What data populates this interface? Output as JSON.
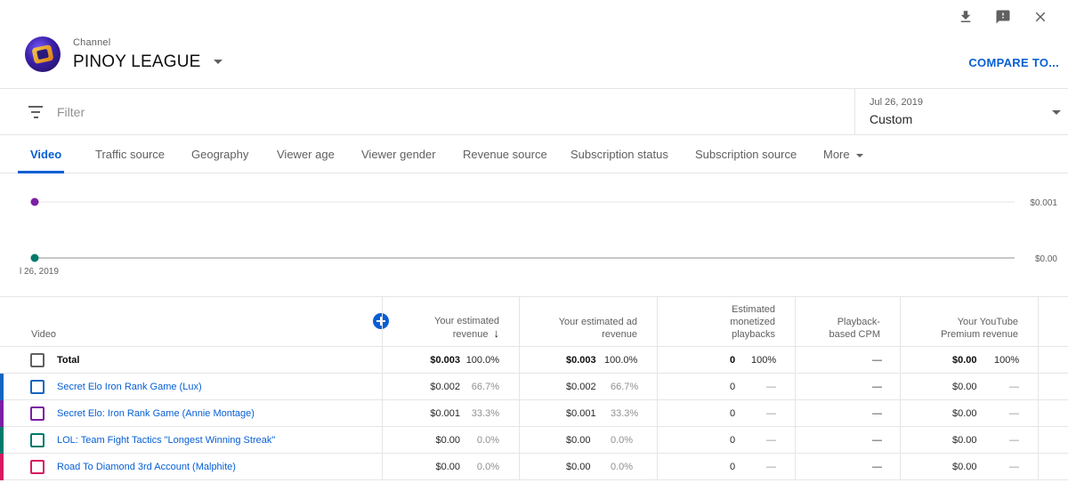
{
  "header": {
    "channel_label": "Channel",
    "channel_name": "PINOY LEAGUE",
    "compare_label": "COMPARE TO..."
  },
  "icons": {
    "download": "download-icon",
    "feedback": "feedback-icon",
    "close": "close-icon"
  },
  "filter": {
    "placeholder": "Filter",
    "date_range": "Jul 26, 2019",
    "date_label": "Custom"
  },
  "tabs": [
    {
      "label": "Video",
      "active": true
    },
    {
      "label": "Traffic source"
    },
    {
      "label": "Geography"
    },
    {
      "label": "Viewer age"
    },
    {
      "label": "Viewer gender"
    },
    {
      "label": "Revenue source"
    },
    {
      "label": "Subscription status"
    },
    {
      "label": "Subscription source"
    },
    {
      "label": "More"
    }
  ],
  "chart_data": {
    "type": "line",
    "x": [
      "l 26, 2019"
    ],
    "y_ticks": [
      "$0.001",
      "$0.00"
    ],
    "series": [
      {
        "color": "#7b1fa2",
        "values": [
          0.001
        ]
      },
      {
        "color": "#00796b",
        "values": [
          0.0
        ]
      }
    ],
    "grid": true
  },
  "table": {
    "columns": {
      "video": "Video",
      "est_revenue_1": "Your estimated",
      "est_revenue_2": "revenue",
      "ad_revenue_1": "Your estimated ad",
      "ad_revenue_2": "revenue",
      "monetized_1": "Estimated",
      "monetized_2": "monetized",
      "monetized_3": "playbacks",
      "cpm_1": "Playback-",
      "cpm_2": "based CPM",
      "premium_1": "Your YouTube",
      "premium_2": "Premium revenue"
    },
    "sort_arrow": "↓",
    "total": {
      "name": "Total",
      "revenue": "$0.003",
      "revenue_pct": "100.0%",
      "ad_revenue": "$0.003",
      "ad_revenue_pct": "100.0%",
      "playbacks": "0",
      "playbacks_pct": "100%",
      "cpm": "—",
      "premium": "$0.00",
      "premium_pct": "100%"
    },
    "rows": [
      {
        "name": "Secret Elo Iron Rank Game (Lux)",
        "color": "#1565c0",
        "revenue": "$0.002",
        "revenue_pct": "66.7%",
        "ad_revenue": "$0.002",
        "ad_revenue_pct": "66.7%",
        "playbacks": "0",
        "playbacks_pct": "—",
        "cpm": "—",
        "premium": "$0.00",
        "premium_pct": "—"
      },
      {
        "name": "Secret Elo: Iron Rank Game (Annie Montage)",
        "color": "#7b1fa2",
        "revenue": "$0.001",
        "revenue_pct": "33.3%",
        "ad_revenue": "$0.001",
        "ad_revenue_pct": "33.3%",
        "playbacks": "0",
        "playbacks_pct": "—",
        "cpm": "—",
        "premium": "$0.00",
        "premium_pct": "—"
      },
      {
        "name": "LOL: Team Fight Tactics \"Longest Winning Streak\"",
        "color": "#00796b",
        "revenue": "$0.00",
        "revenue_pct": "0.0%",
        "ad_revenue": "$0.00",
        "ad_revenue_pct": "0.0%",
        "playbacks": "0",
        "playbacks_pct": "—",
        "cpm": "—",
        "premium": "$0.00",
        "premium_pct": "—"
      },
      {
        "name": "Road To Diamond 3rd Account (Malphite)",
        "color": "#d81b60",
        "revenue": "$0.00",
        "revenue_pct": "0.0%",
        "ad_revenue": "$0.00",
        "ad_revenue_pct": "0.0%",
        "playbacks": "0",
        "playbacks_pct": "—",
        "cpm": "—",
        "premium": "$0.00",
        "premium_pct": "—"
      }
    ]
  }
}
